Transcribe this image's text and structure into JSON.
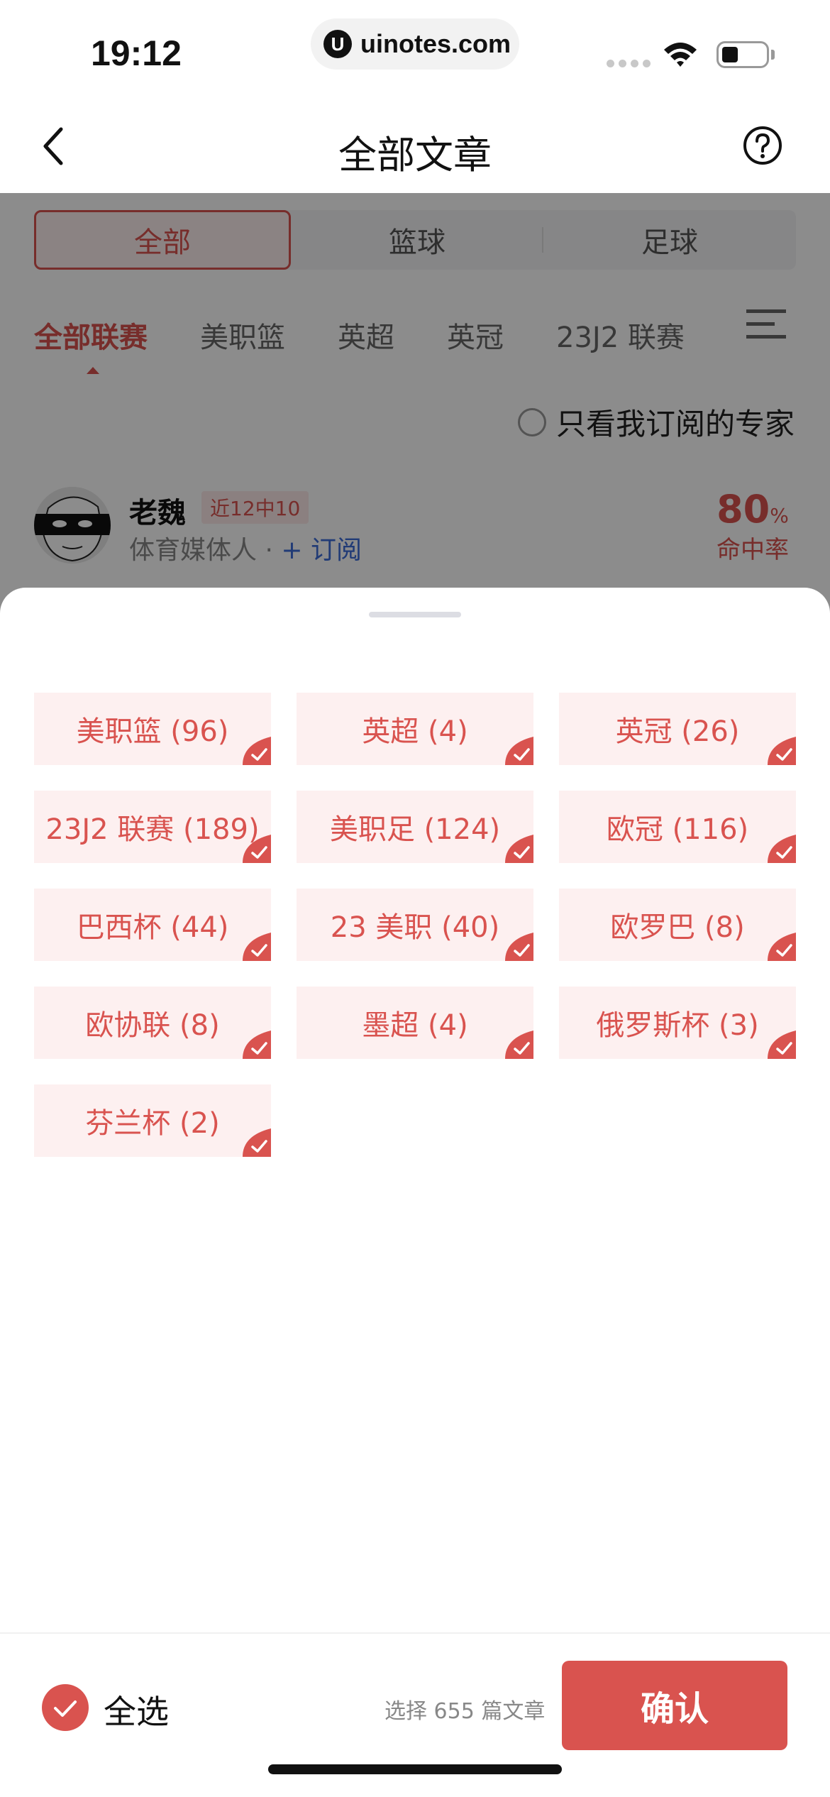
{
  "status_bar": {
    "time": "19:12",
    "url": "uinotes.com",
    "url_logo": "U"
  },
  "nav": {
    "title": "全部文章"
  },
  "segments": [
    {
      "label": "全部",
      "active": true
    },
    {
      "label": "篮球",
      "active": false
    },
    {
      "label": "足球",
      "active": false
    }
  ],
  "league_tabs": [
    {
      "label": "全部联赛",
      "active": true
    },
    {
      "label": "美职篮",
      "active": false
    },
    {
      "label": "英超",
      "active": false
    },
    {
      "label": "英冠",
      "active": false
    },
    {
      "label": "23J2 联赛",
      "active": false
    }
  ],
  "subscribed_only_label": "只看我订阅的专家",
  "expert": {
    "name": "老魏",
    "badge": "近12中10",
    "desc": "体育媒体人 · ",
    "subscribe": "+ 订阅",
    "hit_rate_value": "80",
    "hit_rate_unit": "%",
    "hit_rate_label": "命中率"
  },
  "leagues": [
    "美职篮 (96)",
    "英超 (4)",
    "英冠 (26)",
    "23J2 联赛 (189)",
    "美职足 (124)",
    "欧冠 (116)",
    "巴西杯 (44)",
    "23 美职 (40)",
    "欧罗巴 (8)",
    "欧协联 (8)",
    "墨超 (4)",
    "俄罗斯杯 (3)",
    "芬兰杯 (2)"
  ],
  "footer": {
    "select_all": "全选",
    "count_text": "选择 655 篇文章",
    "confirm": "确认"
  },
  "colors": {
    "accent": "#d9534f",
    "chip_bg": "#fdf0f0"
  }
}
